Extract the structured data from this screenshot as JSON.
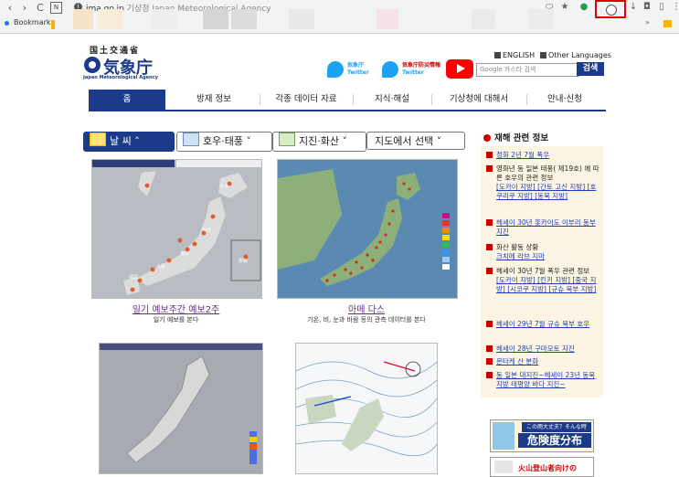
{
  "browser": {
    "url_host": "jma.go.jp",
    "page_title_hint": "기상청 Japan Meteorological Agency",
    "bookmarks_label": "Bookmarks",
    "nav_back": "‹",
    "nav_forward": "›",
    "nav_reload": "C"
  },
  "header": {
    "ministry": "国土交通省",
    "agency_name": "気象庁",
    "agency_english": "Japan Meteorological Agency",
    "twitter1_line1": "気象庁",
    "twitter1_line2": "Twitter",
    "twitter2_line1": "気象庁防災情報",
    "twitter2_line2": "Twitter",
    "lang_english": "ENGLISH",
    "lang_other": "Other Languages",
    "search_placeholder": "Google 카스타 검색",
    "search_button": "검색"
  },
  "main_nav": [
    {
      "label": "홈",
      "active": true
    },
    {
      "label": "방재 정보",
      "active": false
    },
    {
      "label": "각종 데이터 자료",
      "active": false
    },
    {
      "label": "지식·해설",
      "active": false
    },
    {
      "label": "기상청에 대해서",
      "active": false
    },
    {
      "label": "안내·신청",
      "active": false
    }
  ],
  "tabs": [
    {
      "label": "날 씨 ˄",
      "active": true
    },
    {
      "label": "호우·태풍 ˅",
      "active": false
    },
    {
      "label": "지진·화산 ˅",
      "active": false
    },
    {
      "label": "지도에서 선택 ˅",
      "active": false
    }
  ],
  "maps": [
    {
      "label": "일기 예보주간 예보2주",
      "desc": "일기 예보를 본다"
    },
    {
      "label": "아메 다스",
      "desc": "기온, 비, 눈과 바람 등의 관측 데이터를 본다"
    }
  ],
  "disaster": {
    "title": "재해 관련 정보",
    "items": [
      {
        "text": "정화 2년 7월 폭우",
        "link": true
      },
      {
        "text": "영화년 동 일본 태풍( 제19호) 에 따른 호우의 관련 정보",
        "link": false,
        "sublinks": "[도카이 지방] [간토 고신 지방] [호쿠리쿠 지방] [동북 지방]"
      },
      {
        "text": "헤세이 30년 홋카이도 이부리 동부 지진",
        "link": true
      },
      {
        "text": "화산 활동 상황",
        "link": false,
        "sublinks": "크치에 라브 지마"
      },
      {
        "text": "헤세이 30년 7월 폭우 관련 정보",
        "link": false,
        "sublinks": "[도카이 지방] [킨키 지방] [중국 지방] [시코쿠 지방] [규슈 북부 지방]"
      },
      {
        "text": "헤세이 29년 7월 규슈 북부 호우",
        "link": true
      },
      {
        "text": "헤세이 28년 구마모토 지진",
        "link": true
      },
      {
        "text": "온타케 산 분화",
        "link": true
      },
      {
        "text": "동 일본 대지진~헤세이 23년 동북 지방 태평양 바다 지진~",
        "link": true
      }
    ]
  },
  "banners": {
    "kikendo_line1": "この雨大丈夫？そんな時",
    "kikendo_line2": "危険度分布",
    "volcano": "火山登山者向けの"
  },
  "colors": {
    "brand_navy": "#1b3a8a",
    "alert_red": "#cc0000",
    "panel_bg": "#fdf5e4",
    "twitter": "#1da1f2",
    "youtube": "#ff0000"
  },
  "icons": [
    "back-icon",
    "forward-icon",
    "reload-icon",
    "info-icon",
    "star-icon",
    "bookmark-folder-icon",
    "twitter-bird-icon",
    "youtube-play-icon",
    "sun-cloud-icon",
    "typhoon-icon",
    "volcano-icon"
  ]
}
